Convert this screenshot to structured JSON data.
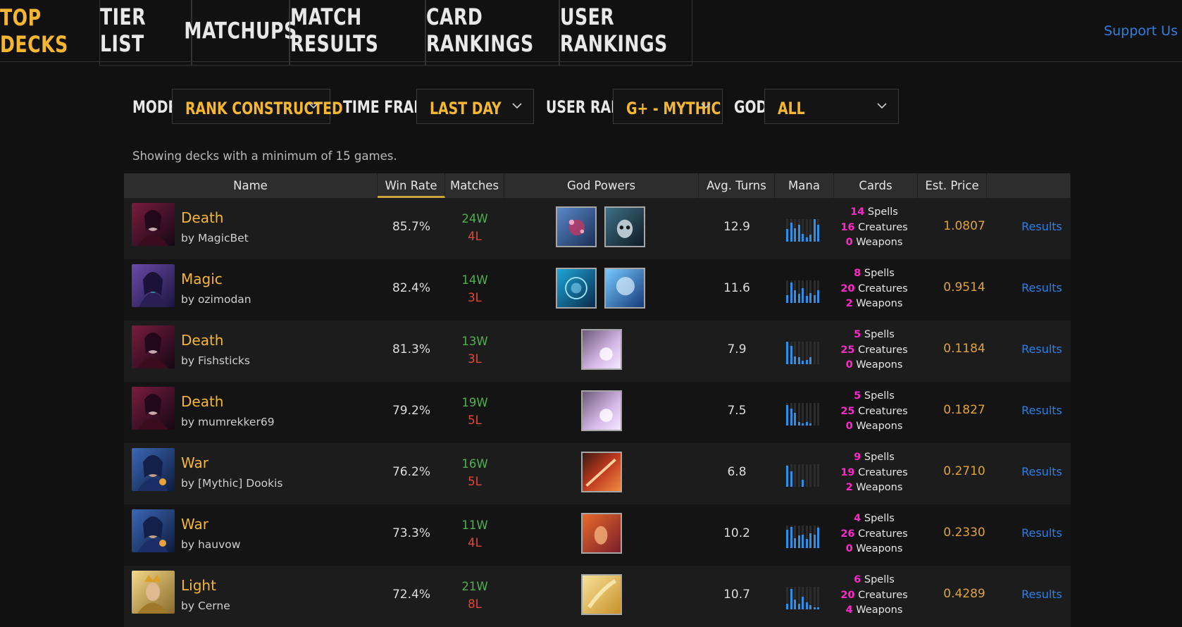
{
  "nav": {
    "tabs": [
      {
        "label": "TOP DECKS",
        "active": true
      },
      {
        "label": "TIER LIST",
        "active": false
      },
      {
        "label": "MATCHUPS",
        "active": false
      },
      {
        "label": "MATCH RESULTS",
        "active": false
      },
      {
        "label": "CARD RANKINGS",
        "active": false
      },
      {
        "label": "USER RANKINGS",
        "active": false
      }
    ],
    "support": "Support Us"
  },
  "filters": {
    "mode_label": "MODE:",
    "mode_value": "RANK CONSTRUCTED",
    "time_label": "TIME FRAME:",
    "time_value": "LAST DAY",
    "rank_label": "USER RANK:",
    "rank_value": "G+ - MYTHIC",
    "god_label": "GOD:",
    "god_value": "ALL"
  },
  "note": "Showing decks with a minimum of 15 games.",
  "table": {
    "headers": [
      "Name",
      "Win Rate",
      "Matches",
      "God Powers",
      "Avg. Turns",
      "Mana",
      "Cards",
      "Est. Price",
      ""
    ],
    "results_label": "Results",
    "spells_label": "Spells",
    "creatures_label": "Creatures",
    "weapons_label": "Weapons",
    "rows": [
      {
        "god": "Death",
        "author": "by MagicBet",
        "win_rate": "85.7%",
        "wins": "24W",
        "losses": "4L",
        "avg_turns": "12.9",
        "spells": "14",
        "creatures": "16",
        "weapons": "0",
        "price": "1.0807"
      },
      {
        "god": "Magic",
        "author": "by ozimodan",
        "win_rate": "82.4%",
        "wins": "14W",
        "losses": "3L",
        "avg_turns": "11.6",
        "spells": "8",
        "creatures": "20",
        "weapons": "2",
        "price": "0.9514"
      },
      {
        "god": "Death",
        "author": "by Fishsticks",
        "win_rate": "81.3%",
        "wins": "13W",
        "losses": "3L",
        "avg_turns": "7.9",
        "spells": "5",
        "creatures": "25",
        "weapons": "0",
        "price": "0.1184"
      },
      {
        "god": "Death",
        "author": "by mumrekker69",
        "win_rate": "79.2%",
        "wins": "19W",
        "losses": "5L",
        "avg_turns": "7.5",
        "spells": "5",
        "creatures": "25",
        "weapons": "0",
        "price": "0.1827"
      },
      {
        "god": "War",
        "author": "by [Mythic] Dookis",
        "win_rate": "76.2%",
        "wins": "16W",
        "losses": "5L",
        "avg_turns": "6.8",
        "spells": "9",
        "creatures": "19",
        "weapons": "2",
        "price": "0.2710"
      },
      {
        "god": "War",
        "author": "by hauvow",
        "win_rate": "73.3%",
        "wins": "11W",
        "losses": "4L",
        "avg_turns": "10.2",
        "spells": "4",
        "creatures": "26",
        "weapons": "0",
        "price": "0.2330"
      },
      {
        "god": "Light",
        "author": "by Cerne",
        "win_rate": "72.4%",
        "wins": "21W",
        "losses": "8L",
        "avg_turns": "10.7",
        "spells": "6",
        "creatures": "20",
        "weapons": "4",
        "price": "0.4289"
      }
    ]
  },
  "mana_curves": [
    [
      0.55,
      0.85,
      0.6,
      0.75,
      0.35,
      0.2,
      0.3,
      1.0,
      0.75
    ],
    [
      0.35,
      0.9,
      0.55,
      0.4,
      0.65,
      0.3,
      0.45,
      0.35,
      0.55
    ],
    [
      1.0,
      0.8,
      0.35,
      0.3,
      0.15,
      0.2,
      0.3,
      0.0,
      0.0
    ],
    [
      0.9,
      0.75,
      0.55,
      0.15,
      0.1,
      0.15,
      0.1,
      0.0,
      0.0
    ],
    [
      0.95,
      0.7,
      0.0,
      0.0,
      0.3,
      0.0,
      0.0,
      0.0,
      0.0
    ],
    [
      0.8,
      0.95,
      0.45,
      0.55,
      0.6,
      0.4,
      0.65,
      0.6,
      0.9
    ],
    [
      0.25,
      0.9,
      0.45,
      0.25,
      0.55,
      0.3,
      0.2,
      0.1,
      0.1
    ]
  ]
}
